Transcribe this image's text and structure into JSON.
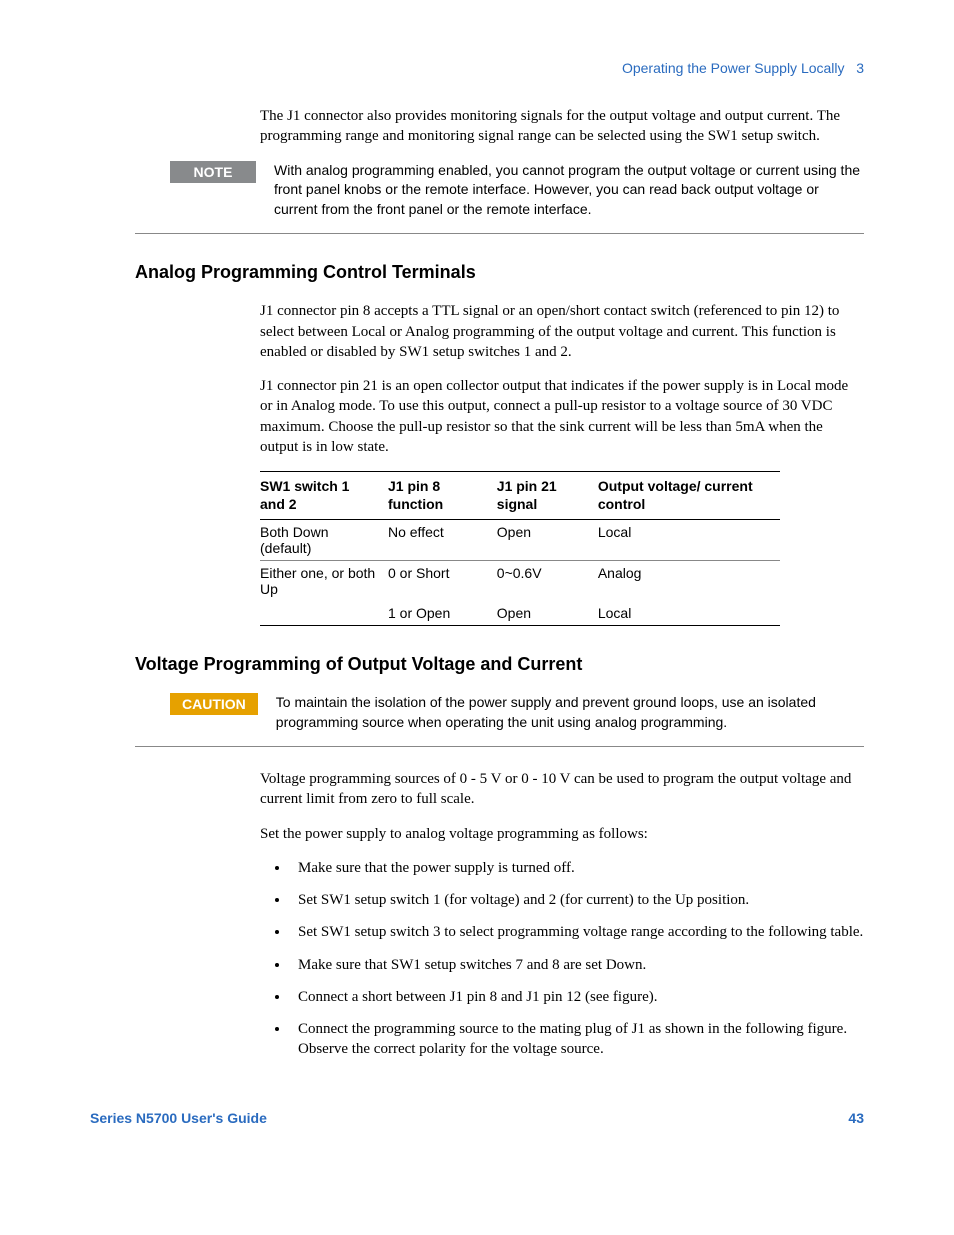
{
  "header": {
    "section": "Operating the Power Supply Locally",
    "chapter": "3"
  },
  "intro_para": "The J1 connector also provides monitoring signals for the output voltage and output current. The programming range and monitoring signal range can be selected using the SW1 setup switch.",
  "note": {
    "label": "NOTE",
    "text": "With analog programming enabled, you cannot program the output voltage or current using the front panel knobs or the remote interface. However, you can read back output voltage or current from the front panel or the remote interface."
  },
  "section1": {
    "heading": "Analog Programming Control Terminals",
    "p1": "J1 connector pin 8 accepts a TTL signal or an open/short contact switch (referenced to pin 12) to select between Local or Analog programming of the output voltage and current. This function is enabled or disabled by SW1 setup switches 1 and 2.",
    "p2": "J1 connector pin 21 is an open collector output that indicates if the power supply is in Local mode or in Analog mode. To use this output, connect a pull-up resistor to a voltage source of 30 VDC maximum. Choose the pull-up resistor so that the sink current will be less than 5mA when the output is in low state.",
    "table": {
      "headers": [
        "SW1 switch 1 and 2",
        "J1 pin 8 function",
        "J1 pin 21 signal",
        "Output voltage/ current control"
      ],
      "rows": [
        [
          "Both Down (default)",
          "No effect",
          "Open",
          "Local"
        ],
        [
          "Either one, or both Up",
          "0 or Short",
          "0~0.6V",
          "Analog"
        ],
        [
          "",
          "1 or Open",
          "Open",
          "Local"
        ]
      ]
    }
  },
  "section2": {
    "heading": "Voltage Programming of Output Voltage and Current",
    "caution": {
      "label": "CAUTION",
      "text": "To maintain the isolation of the power supply and prevent ground loops, use an isolated programming source when operating the unit using analog programming."
    },
    "p1": "Voltage programming sources of 0 - 5 V or 0 - 10 V can be used to program the output voltage and current limit from zero to full scale.",
    "p2": "Set the power supply to analog voltage programming as follows:",
    "steps": [
      "Make sure that the power supply is turned off.",
      "Set SW1 setup switch 1 (for voltage) and 2 (for current) to the Up position.",
      "Set SW1 setup switch 3 to select programming voltage range according to the following table.",
      "Make sure that SW1 setup switches 7 and 8 are set Down.",
      "Connect a short between J1 pin 8 and J1 pin 12 (see figure).",
      "Connect the programming source to the mating plug of J1 as shown in the following figure. Observe the correct polarity for the voltage source."
    ]
  },
  "footer": {
    "left": "Series N5700 User's Guide",
    "right": "43"
  }
}
